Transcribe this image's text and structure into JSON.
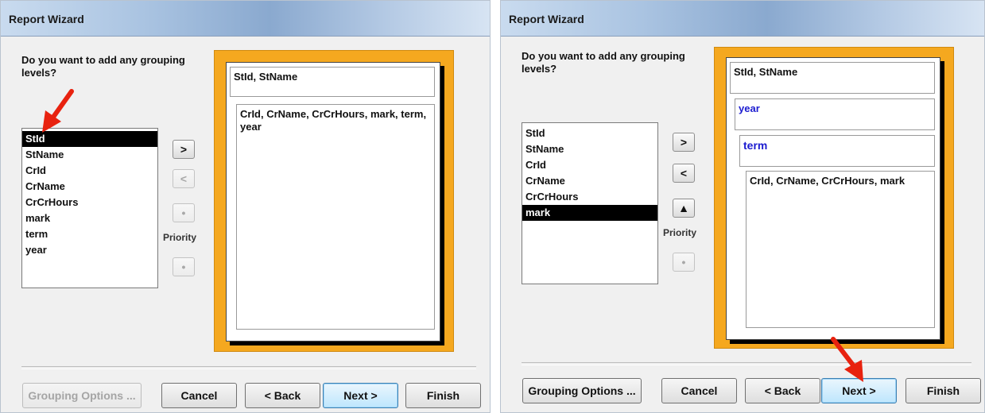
{
  "left": {
    "title": "Report Wizard",
    "question": "Do you want to add any grouping levels?",
    "fields": [
      {
        "label": "StId",
        "selected": true
      },
      {
        "label": "StName",
        "selected": false
      },
      {
        "label": "CrId",
        "selected": false
      },
      {
        "label": "CrName",
        "selected": false
      },
      {
        "label": "CrCrHours",
        "selected": false
      },
      {
        "label": "mark",
        "selected": false
      },
      {
        "label": "term",
        "selected": false
      },
      {
        "label": "year",
        "selected": false
      }
    ],
    "buttons": {
      "add": ">",
      "remove": "<",
      "priority_up": "•",
      "priority_label": "Priority",
      "priority_down": "•"
    },
    "preview": {
      "group1": "StId, StName",
      "detail": "CrId, CrName, CrCrHours, mark, term, year"
    },
    "footer": {
      "grouping_options": "Grouping Options ...",
      "cancel": "Cancel",
      "back": "< Back",
      "next": "Next >",
      "finish": "Finish"
    }
  },
  "right": {
    "title": "Report Wizard",
    "question": "Do you want to add any grouping levels?",
    "fields": [
      {
        "label": "StId",
        "selected": false
      },
      {
        "label": "StName",
        "selected": false
      },
      {
        "label": "CrId",
        "selected": false
      },
      {
        "label": "CrName",
        "selected": false
      },
      {
        "label": "CrCrHours",
        "selected": false
      },
      {
        "label": "mark",
        "selected": true
      }
    ],
    "buttons": {
      "add": ">",
      "remove": "<",
      "priority_up": "▲",
      "priority_label": "Priority",
      "priority_down": "•"
    },
    "preview": {
      "group1": "StId, StName",
      "group2": "year",
      "group3": "term",
      "detail": "CrId, CrName, CrCrHours, mark"
    },
    "footer": {
      "grouping_options": "Grouping Options ...",
      "cancel": "Cancel",
      "back": "< Back",
      "next": "Next >",
      "finish": "Finish"
    }
  },
  "accent": {
    "highlight": "#f5a81f",
    "group_text": "#1b1bd0",
    "annotation_arrow": "#e8220f"
  }
}
